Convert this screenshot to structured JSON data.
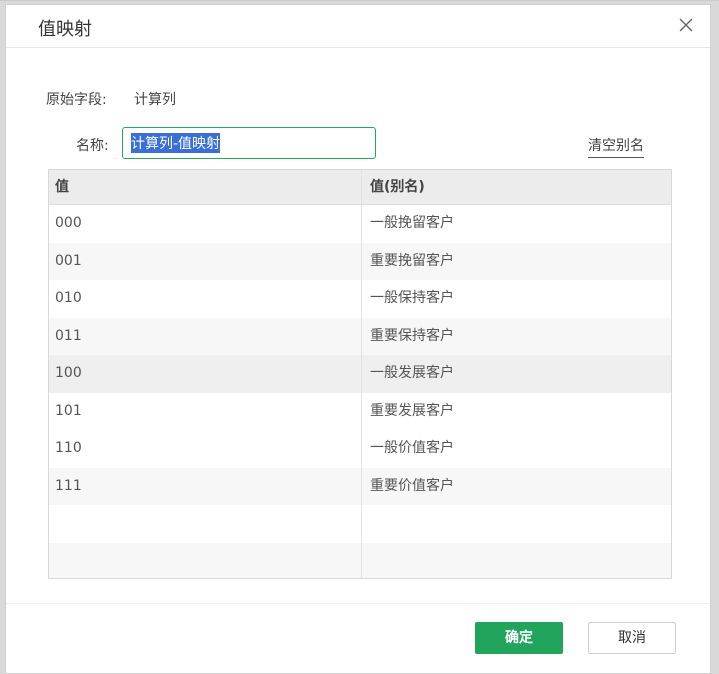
{
  "dialog": {
    "title": "值映射",
    "source_field_label": "原始字段:",
    "source_field_value": "计算列",
    "name_label": "名称:",
    "name_value": "计算列-值映射",
    "clear_alias_label": "清空别名",
    "ok_label": "确定",
    "cancel_label": "取消"
  },
  "table": {
    "headers": [
      "值",
      "值(别名)"
    ],
    "rows": [
      {
        "value": "000",
        "alias": "一般挽留客户"
      },
      {
        "value": "001",
        "alias": "重要挽留客户"
      },
      {
        "value": "010",
        "alias": "一般保持客户"
      },
      {
        "value": "011",
        "alias": "重要保持客户"
      },
      {
        "value": "100",
        "alias": "一般发展客户"
      },
      {
        "value": "101",
        "alias": "重要发展客户"
      },
      {
        "value": "110",
        "alias": "一般价值客户"
      },
      {
        "value": "111",
        "alias": "重要价值客户"
      },
      {
        "value": "",
        "alias": ""
      },
      {
        "value": "",
        "alias": ""
      }
    ]
  },
  "colors": {
    "primary": "#21a55d",
    "input_border": "#2aa85a",
    "selection": "#3a6fd8"
  },
  "icons": [
    "close-icon"
  ]
}
